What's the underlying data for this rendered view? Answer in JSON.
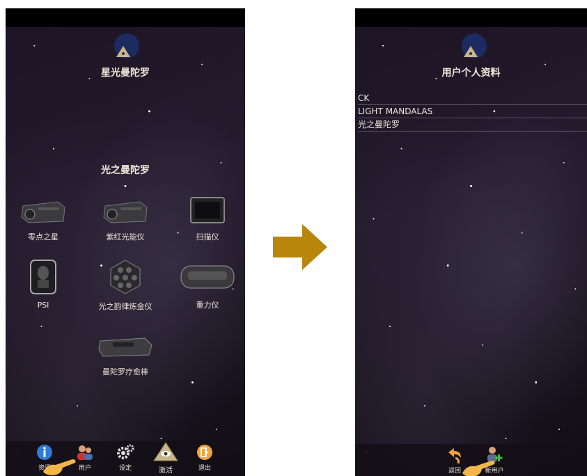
{
  "left_screen": {
    "app_title": "星光曼陀罗",
    "section_title": "光之曼陀罗",
    "devices": [
      {
        "label": "零点之星",
        "icon": "projector-device-icon"
      },
      {
        "label": "紫红光能仪",
        "icon": "projector-device-icon"
      },
      {
        "label": "扫描仪",
        "icon": "scanner-device-icon"
      },
      {
        "label": "PSI",
        "icon": "psi-device-icon"
      },
      {
        "label": "光之韵律炼金仪",
        "icon": "led-cluster-device-icon"
      },
      {
        "label": "重力仪",
        "icon": "gravity-device-icon"
      },
      {
        "label": "曼陀罗疗愈棒",
        "icon": "healing-wand-device-icon"
      }
    ],
    "nav": [
      {
        "label": "资讯",
        "icon": "info-icon"
      },
      {
        "label": "用户",
        "icon": "users-icon"
      },
      {
        "label": "设定",
        "icon": "gear-icon"
      },
      {
        "label": "激活",
        "icon": "pyramid-eye-icon"
      },
      {
        "label": "退出",
        "icon": "exit-icon"
      }
    ]
  },
  "right_screen": {
    "title": "用户个人资料",
    "users": [
      "CK",
      "LIGHT MANDALAS",
      "光之曼陀罗"
    ],
    "nav": [
      {
        "label": "返回",
        "icon": "back-arrow-icon"
      },
      {
        "label": "新用户",
        "icon": "add-user-icon"
      }
    ]
  },
  "colors": {
    "arrow": "#b8860b",
    "accent_orange": "#f2a33a",
    "background": "#1f1726"
  }
}
